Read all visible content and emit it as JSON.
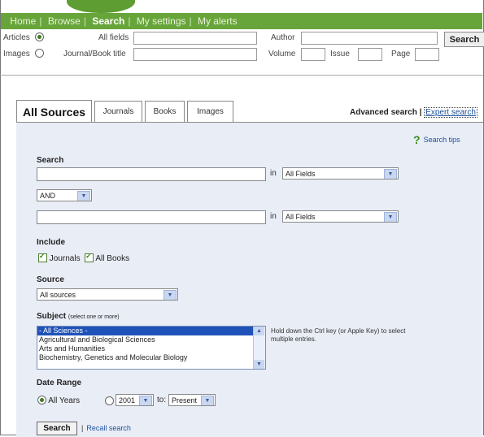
{
  "nav": {
    "items": [
      "Home",
      "Browse",
      "Search",
      "My settings",
      "My alerts"
    ],
    "active": "Search"
  },
  "quick_search": {
    "articles_label": "Articles",
    "images_label": "Images",
    "all_fields_label": "All fields",
    "journal_label": "Journal/Book title",
    "author_label": "Author",
    "volume_label": "Volume",
    "issue_label": "Issue",
    "page_label": "Page",
    "search_button": "Search"
  },
  "tabs": [
    "All Sources",
    "Journals",
    "Books",
    "Images"
  ],
  "links": {
    "advanced": "Advanced search",
    "separator": "|",
    "expert": "Expert search",
    "tips": "Search tips"
  },
  "form": {
    "search_heading": "Search",
    "in_label": "in",
    "field1_scope": "All Fields",
    "operator": "AND",
    "field2_scope": "All Fields",
    "include_heading": "Include",
    "journals_label": "Journals",
    "books_label": "All Books",
    "source_heading": "Source",
    "source_value": "All sources",
    "subject_heading": "Subject",
    "subject_note": "(select one or more)",
    "subjects": [
      "- All Sciences -",
      "Agricultural and Biological Sciences",
      "Arts and Humanities",
      "Biochemistry, Genetics and Molecular Biology"
    ],
    "subject_hint": "Hold down the Ctrl key (or Apple Key) to select multiple entries.",
    "date_heading": "Date Range",
    "all_years_label": "All Years",
    "from_year": "2001",
    "to_label": "to:",
    "to_value": "Present",
    "search_button": "Search",
    "recall_separator": "|",
    "recall_label": "Recall search"
  }
}
